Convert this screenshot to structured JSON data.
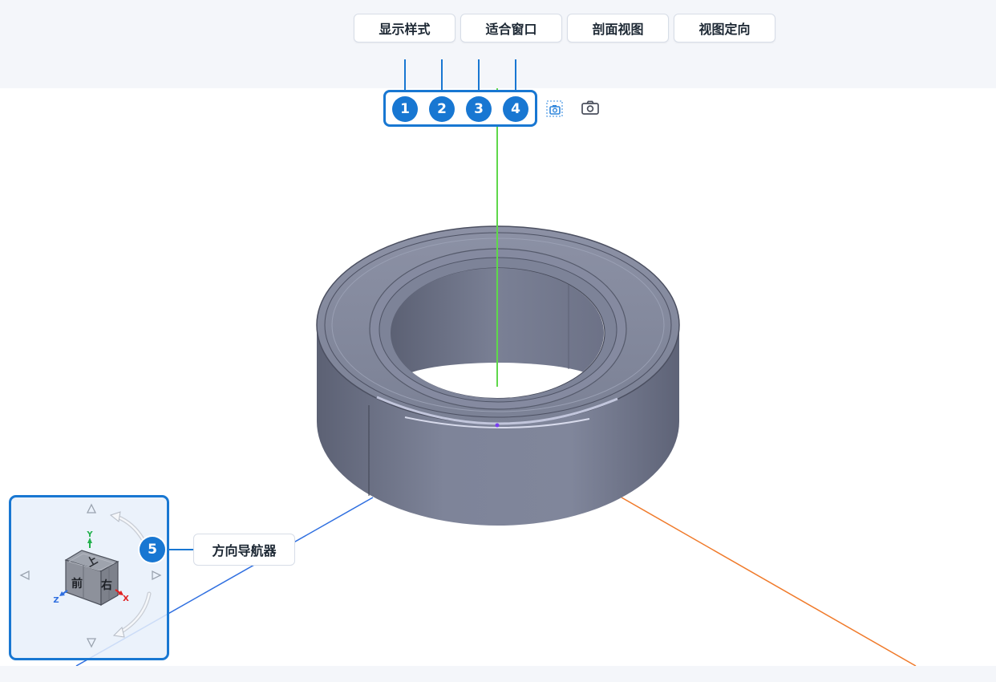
{
  "callouts": [
    {
      "number": "1",
      "label": "显示样式"
    },
    {
      "number": "2",
      "label": "适合窗口"
    },
    {
      "number": "3",
      "label": "剖面视图"
    },
    {
      "number": "4",
      "label": "视图定向"
    },
    {
      "number": "5",
      "label": "方向导航器"
    }
  ],
  "toolbar": {
    "icons": [
      "screenshot-region-icon",
      "camera-icon"
    ]
  },
  "view_cube": {
    "faces": {
      "top": "上",
      "front": "前",
      "right": "右"
    },
    "axes": {
      "x": "X",
      "y": "Y",
      "z": "Z"
    }
  },
  "colors": {
    "accent": "#1877d2",
    "axis_x": "#f07a2a",
    "axis_y": "#5fd84a",
    "axis_z": "#2f6fe0",
    "model": "#7c8296"
  }
}
